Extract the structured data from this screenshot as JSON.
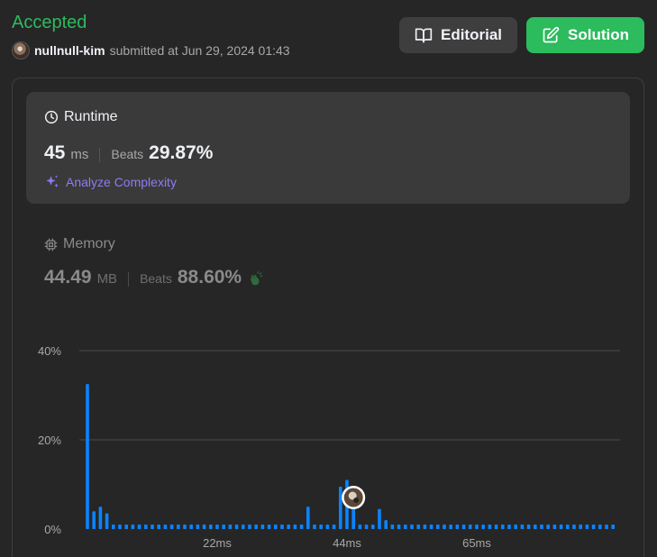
{
  "header": {
    "status": "Accepted",
    "username": "nullnull-kim",
    "submitted_text": "submitted at Jun 29, 2024 01:43"
  },
  "buttons": {
    "editorial_label": "Editorial",
    "solution_label": "Solution"
  },
  "runtime": {
    "title": "Runtime",
    "value": "45",
    "unit": "ms",
    "beats_label": "Beats",
    "beats_value": "29.87%",
    "analyze_label": "Analyze Complexity"
  },
  "memory": {
    "title": "Memory",
    "value": "44.49",
    "unit": "MB",
    "beats_label": "Beats",
    "beats_value": "88.60%"
  },
  "icons": {
    "editorial": "book-open-icon",
    "solution": "edit-icon",
    "runtime": "clock-icon",
    "memory": "chip-icon",
    "analyze": "sparkle-icon",
    "beats_memory": "clapping-hands-icon"
  },
  "colors": {
    "accepted": "#2cbb5d",
    "bar": "#0a84ff",
    "analyze": "#8b7cf6",
    "background": "#262626",
    "card": "#3a3a3a"
  },
  "chart_data": {
    "type": "bar",
    "title": "",
    "xlabel": "",
    "ylabel": "",
    "ylim": [
      0,
      40
    ],
    "y_ticks": [
      "0%",
      "20%",
      "40%"
    ],
    "x_tick_labels": [
      {
        "label": "22ms",
        "index": 20
      },
      {
        "label": "44ms",
        "index": 40
      },
      {
        "label": "65ms",
        "index": 60
      }
    ],
    "grid": true,
    "highlight_index": 41,
    "values": [
      32.5,
      4,
      5,
      3.5,
      1,
      1,
      1,
      1,
      1,
      1,
      1,
      1,
      1,
      1,
      1,
      1,
      1,
      1,
      1,
      1,
      1,
      1,
      1,
      1,
      1,
      1,
      1,
      1,
      1,
      1,
      1,
      1,
      1,
      1,
      5,
      1,
      1,
      1,
      1,
      9.5,
      11,
      9.5,
      1,
      1,
      1,
      4.5,
      2,
      1,
      1,
      1,
      1,
      1,
      1,
      1,
      1,
      1,
      1,
      1,
      1,
      1,
      1,
      1,
      1,
      1,
      1,
      1,
      1,
      1,
      1,
      1,
      1,
      1,
      1,
      1,
      1,
      1,
      1,
      1,
      1,
      1,
      1,
      1
    ]
  }
}
